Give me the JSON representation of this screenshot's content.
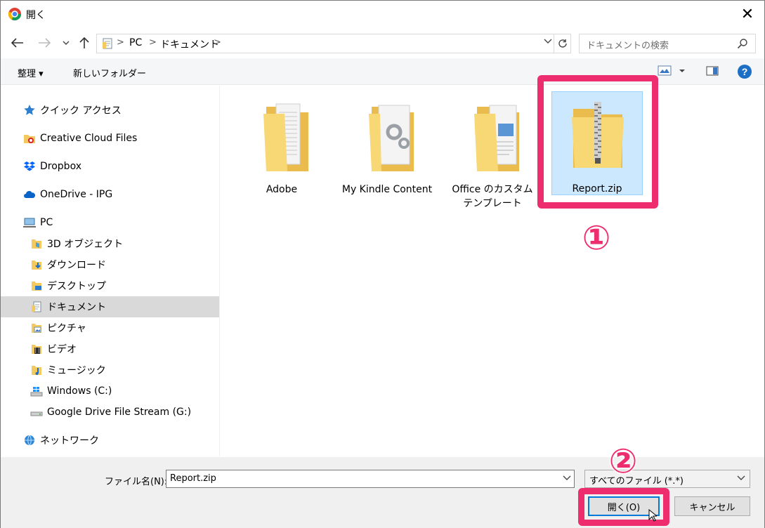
{
  "window": {
    "title": "開く",
    "close_glyph": "✕"
  },
  "address": {
    "parts": [
      "PC",
      "ドキュメント"
    ],
    "search_placeholder": "ドキュメントの検索"
  },
  "toolbar": {
    "organize_label": "整理 ▾",
    "new_folder_label": "新しいフォルダー"
  },
  "nav": {
    "items": [
      {
        "label": "クイック アクセス",
        "icon": "star-icon"
      },
      {
        "label": "Creative Cloud Files",
        "icon": "creative-cloud-icon"
      },
      {
        "label": "Dropbox",
        "icon": "dropbox-icon"
      },
      {
        "label": "OneDrive - IPG",
        "icon": "onedrive-icon"
      },
      {
        "label": "PC",
        "icon": "pc-icon"
      },
      {
        "label": "3D オブジェクト",
        "icon": "3d-objects-icon"
      },
      {
        "label": "ダウンロード",
        "icon": "downloads-icon"
      },
      {
        "label": "デスクトップ",
        "icon": "desktop-icon"
      },
      {
        "label": "ドキュメント",
        "icon": "documents-icon",
        "selected": true
      },
      {
        "label": "ピクチャ",
        "icon": "pictures-icon"
      },
      {
        "label": "ビデオ",
        "icon": "videos-icon"
      },
      {
        "label": "ミュージック",
        "icon": "music-icon"
      },
      {
        "label": "Windows (C:)",
        "icon": "windows-drive-icon"
      },
      {
        "label": "Google Drive File Stream (G:)",
        "icon": "drive-icon"
      },
      {
        "label": "ネットワーク",
        "icon": "network-icon"
      }
    ]
  },
  "files": [
    {
      "name": "Adobe",
      "type": "folder"
    },
    {
      "name": "My Kindle Content",
      "type": "folder"
    },
    {
      "name": "Office のカスタム テンプレート",
      "type": "folder"
    },
    {
      "name": "Report.zip",
      "type": "zip",
      "selected": true
    }
  ],
  "bottom": {
    "filename_label": "ファイル名(N):",
    "filename_value": "Report.zip",
    "filetype_value": "すべてのファイル (*.*)",
    "open_label": "開く(O)",
    "cancel_label": "キャンセル"
  },
  "annotations": {
    "step1": "①",
    "step2": "②",
    "color": "#ee2d6e"
  }
}
